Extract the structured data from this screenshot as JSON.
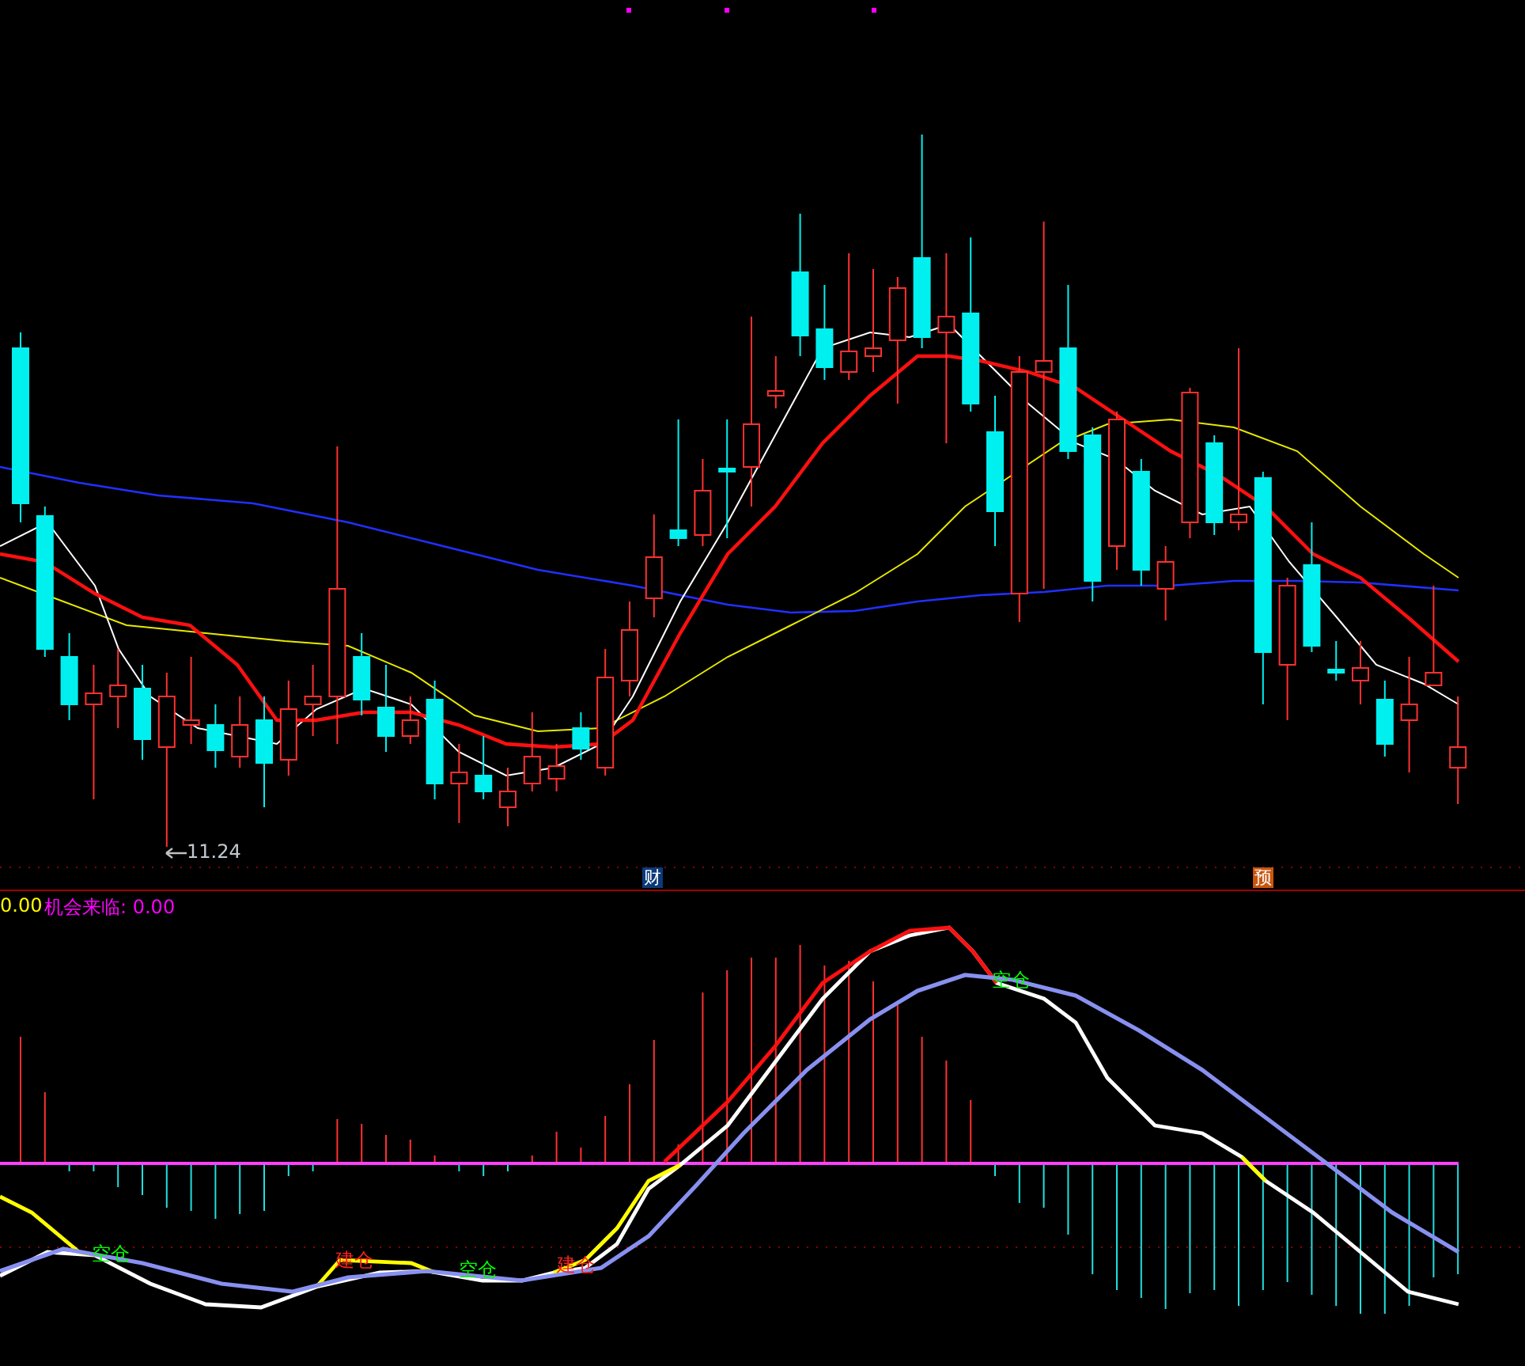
{
  "price_chart": {
    "low_label": "11.24",
    "event_badges": [
      {
        "label": "财",
        "color": "#0b3a78"
      },
      {
        "label": "预",
        "color": "#c8560e"
      }
    ]
  },
  "indicator": {
    "legend": [
      {
        "label": "0.00",
        "color": "#ffff00"
      },
      {
        "label": "机会来临: 0.00",
        "color": "#ff00ff"
      }
    ],
    "signals": [
      {
        "label": "空仓",
        "kind": "exit"
      },
      {
        "label": "建仓",
        "kind": "entry"
      },
      {
        "label": "空仓",
        "kind": "exit"
      },
      {
        "label": "建仓",
        "kind": "entry"
      },
      {
        "label": "空仓",
        "kind": "exit"
      }
    ]
  }
}
